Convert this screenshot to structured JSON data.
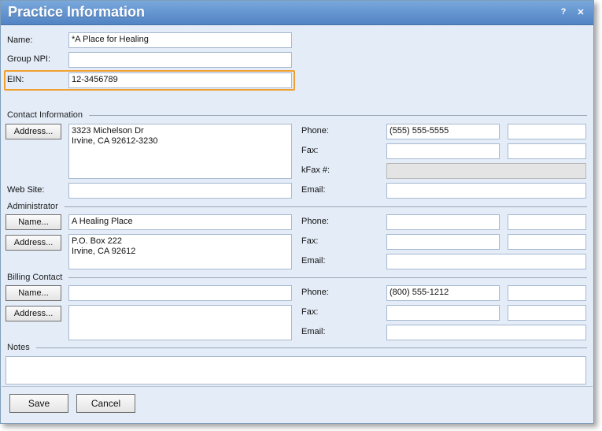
{
  "window": {
    "title": "Practice Information",
    "help_label": "?",
    "close_label": "✕"
  },
  "practice": {
    "name_label": "Name:",
    "name_value": "*A Place for Healing",
    "npi_label": "Group NPI:",
    "npi_value": "",
    "ein_label": "EIN:",
    "ein_value": "12-3456789"
  },
  "contact": {
    "header": "Contact Information",
    "address_button": "Address...",
    "address_lines": [
      "3323 Michelson Dr",
      "Irvine, CA 92612-3230"
    ],
    "website_label": "Web Site:",
    "website_value": "",
    "phone_label": "Phone:",
    "phone_value": "(555) 555-5555",
    "phone_ext": "",
    "fax_label": "Fax:",
    "fax_value": "",
    "fax_ext": "",
    "kfax_label": "kFax #:",
    "kfax_value": "",
    "email_label": "Email:",
    "email_value": ""
  },
  "administrator": {
    "header": "Administrator",
    "name_button": "Name...",
    "name_value": "A Healing Place",
    "address_button": "Address...",
    "address_lines": [
      "P.O. Box 222",
      "Irvine, CA 92612"
    ],
    "phone_label": "Phone:",
    "phone_value": "",
    "phone_ext": "",
    "fax_label": "Fax:",
    "fax_value": "",
    "fax_ext": "",
    "email_label": "Email:",
    "email_value": ""
  },
  "billing": {
    "header": "Billing Contact",
    "name_button": "Name...",
    "name_value": "",
    "address_button": "Address...",
    "address_lines": [
      "",
      ""
    ],
    "phone_label": "Phone:",
    "phone_value": "(800) 555-1212",
    "phone_ext": "",
    "fax_label": "Fax:",
    "fax_value": "",
    "fax_ext": "",
    "email_label": "Email:",
    "email_value": ""
  },
  "notes": {
    "header": "Notes",
    "value": ""
  },
  "footer": {
    "save_label": "Save",
    "cancel_label": "Cancel"
  },
  "colors": {
    "titlebar": "#5283c4",
    "window_bg": "#e3ecf7",
    "highlight": "#f0a030"
  }
}
